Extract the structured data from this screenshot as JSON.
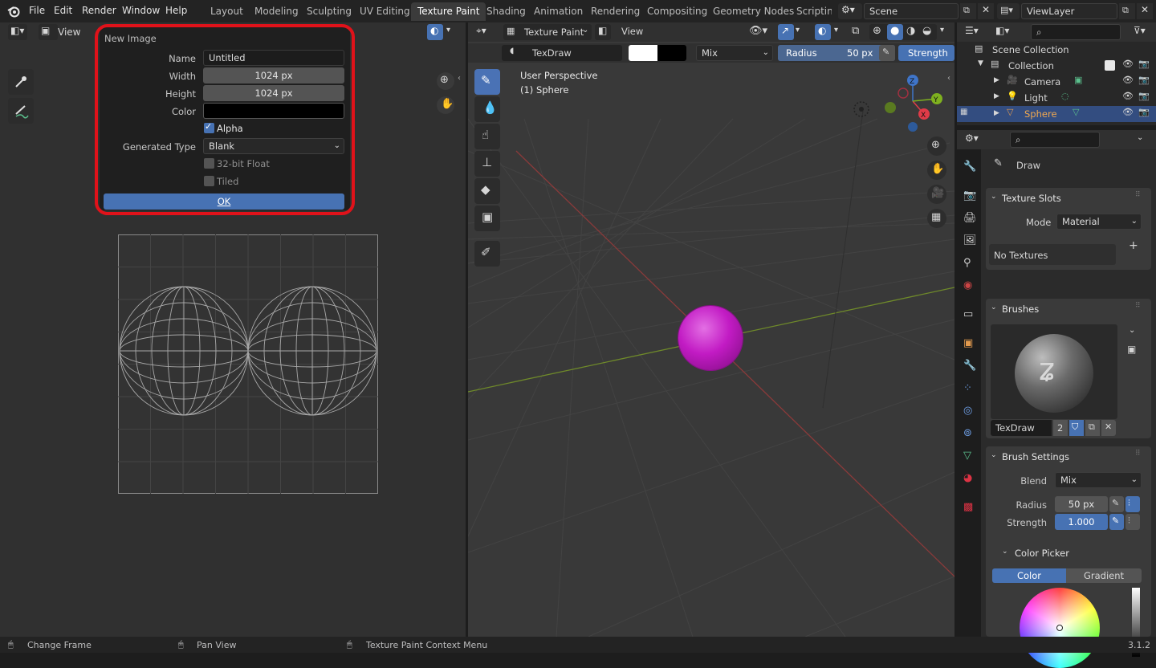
{
  "topbar": {
    "menus": [
      "File",
      "Edit",
      "Render",
      "Window",
      "Help"
    ],
    "workspaces": [
      "Layout",
      "Modeling",
      "Sculpting",
      "UV Editing",
      "Texture Paint",
      "Shading",
      "Animation",
      "Rendering",
      "Compositing",
      "Geometry Nodes",
      "Scripting"
    ],
    "active_workspace": "Texture Paint",
    "scene": "Scene",
    "view_layer": "ViewLayer"
  },
  "image_editor": {
    "view_menu": "View"
  },
  "new_image_dialog": {
    "title": "New Image",
    "name_label": "Name",
    "name_value": "Untitled",
    "width_label": "Width",
    "width_value": "1024 px",
    "height_label": "Height",
    "height_value": "1024 px",
    "color_label": "Color",
    "alpha_label": "Alpha",
    "alpha_checked": true,
    "generated_type_label": "Generated Type",
    "generated_type_value": "Blank",
    "float_label": "32-bit Float",
    "tiled_label": "Tiled",
    "ok_label": "OK"
  },
  "viewport": {
    "mode": "Texture Paint",
    "view_menu": "View",
    "brush_name": "TexDraw",
    "blend": "Mix",
    "radius_label": "Radius",
    "radius_value": "50 px",
    "strength_label": "Strength",
    "perspective": "User Perspective",
    "object": "(1) Sphere",
    "sphere_color": "#c21bc4"
  },
  "outliner": {
    "search_placeholder": "",
    "items": [
      {
        "label": "Scene Collection"
      },
      {
        "label": "Collection"
      },
      {
        "label": "Camera"
      },
      {
        "label": "Light"
      },
      {
        "label": "Sphere"
      }
    ]
  },
  "properties": {
    "tool_name": "Draw",
    "texture_slots": {
      "title": "Texture Slots",
      "mode_label": "Mode",
      "mode_value": "Material",
      "empty_text": "No Textures"
    },
    "brushes": {
      "title": "Brushes",
      "brush_name": "TexDraw",
      "users": "2"
    },
    "brush_settings": {
      "title": "Brush Settings",
      "blend_label": "Blend",
      "blend_value": "Mix",
      "radius_label": "Radius",
      "radius_value": "50 px",
      "strength_label": "Strength",
      "strength_value": "1.000"
    },
    "color_picker": {
      "title": "Color Picker",
      "tab_color": "Color",
      "tab_gradient": "Gradient"
    }
  },
  "statusbar": {
    "items": [
      "Change Frame",
      "Pan View",
      "Texture Paint Context Menu"
    ],
    "version": "3.1.2"
  },
  "colors": {
    "accent": "#4772b3",
    "highlight_ring": "#e0121a"
  }
}
